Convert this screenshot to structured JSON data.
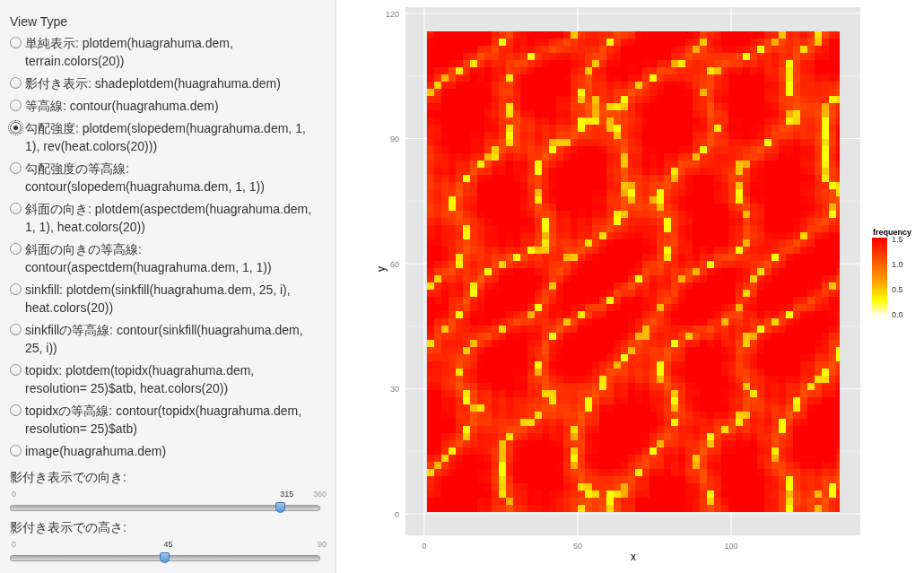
{
  "sidebar": {
    "view_type_label": "View Type",
    "options": [
      {
        "label": "単純表示: plotdem(huagrahuma.dem, terrain.colors(20))",
        "selected": false
      },
      {
        "label": "影付き表示: shadeplotdem(huagrahuma.dem)",
        "selected": false
      },
      {
        "label": "等高線: contour(huagrahuma.dem)",
        "selected": false
      },
      {
        "label": "勾配強度: plotdem(slopedem(huagrahuma.dem, 1, 1), rev(heat.colors(20)))",
        "selected": true
      },
      {
        "label": "勾配強度の等高線: contour(slopedem(huagrahuma.dem, 1, 1))",
        "selected": false
      },
      {
        "label": "斜面の向き: plotdem(aspectdem(huagrahuma.dem, 1, 1), heat.colors(20))",
        "selected": false
      },
      {
        "label": "斜面の向きの等高線: contour(aspectdem(huagrahuma.dem, 1, 1))",
        "selected": false
      },
      {
        "label": "sinkfill: plotdem(sinkfill(huagrahuma.dem, 25, i), heat.colors(20))",
        "selected": false
      },
      {
        "label": "sinkfillの等高線: contour(sinkfill(huagrahuma.dem, 25, i))",
        "selected": false
      },
      {
        "label": "topidx: plotdem(topidx(huagrahuma.dem, resolution= 25)$atb, heat.colors(20))",
        "selected": false
      },
      {
        "label": "topidxの等高線: contour(topidx(huagrahuma.dem, resolution= 25)$atb)",
        "selected": false
      },
      {
        "label": "image(huagrahuma.dem)",
        "selected": false
      }
    ],
    "sliders": [
      {
        "label": "影付き表示での向き:",
        "min": "0",
        "max": "360",
        "value": "315",
        "level": 0.875
      },
      {
        "label": "影付き表示での高さ:",
        "min": "0",
        "max": "90",
        "value": "45",
        "level": 0.5
      }
    ]
  },
  "plot": {
    "x_axis": {
      "title": "x",
      "ticks": [
        "0",
        "50",
        "100"
      ]
    },
    "y_axis": {
      "title": "y",
      "ticks": [
        "120",
        "90",
        "60",
        "30",
        "0"
      ]
    },
    "legend": {
      "title": "frequency",
      "ticks": [
        "1.5",
        "1.0",
        "0.5",
        "0.0"
      ]
    }
  }
}
